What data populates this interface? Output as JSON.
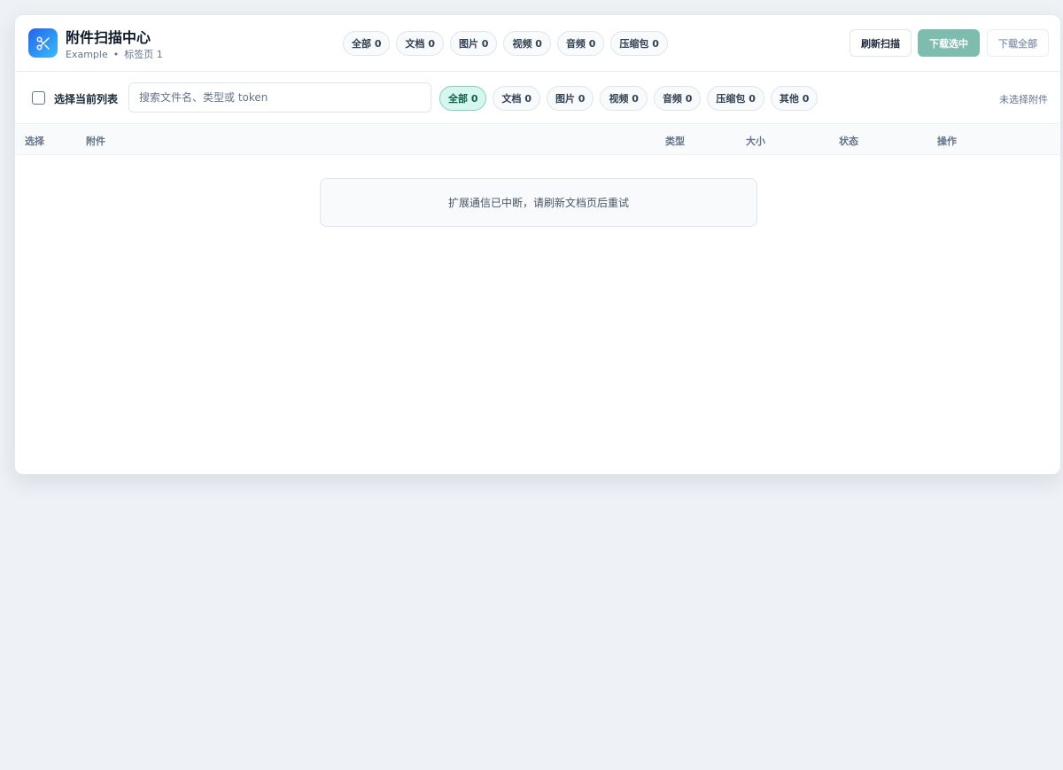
{
  "app": {
    "title": "附件扫描中心",
    "subtitle_site": "Example",
    "subtitle_separator": "•",
    "subtitle_tab": "标签页 1",
    "logo_icon": "scissors-icon",
    "accent_color": "#2563eb"
  },
  "header_chips": [
    {
      "label": "全部 0"
    },
    {
      "label": "文档 0"
    },
    {
      "label": "图片 0"
    },
    {
      "label": "视频 0"
    },
    {
      "label": "音频 0"
    },
    {
      "label": "压缩包 0"
    }
  ],
  "actions": {
    "refresh": "刷新扫描",
    "download_selected": "下载选中",
    "download_all": "下载全部"
  },
  "toolbar": {
    "select_all_label": "选择当前列表",
    "search_placeholder": "搜索文件名、类型或 token",
    "search_value": "",
    "selection_status": "未选择附件"
  },
  "filter_chips": [
    {
      "label": "全部 0",
      "active": true
    },
    {
      "label": "文档 0",
      "active": false
    },
    {
      "label": "图片 0",
      "active": false
    },
    {
      "label": "视频 0",
      "active": false
    },
    {
      "label": "音频 0",
      "active": false
    },
    {
      "label": "压缩包 0",
      "active": false
    },
    {
      "label": "其他 0",
      "active": false
    }
  ],
  "table": {
    "columns": [
      "选择",
      "附件",
      "类型",
      "大小",
      "状态",
      "操作"
    ],
    "rows": []
  },
  "empty_message": "扩展通信已中断，请刷新文档页后重试"
}
